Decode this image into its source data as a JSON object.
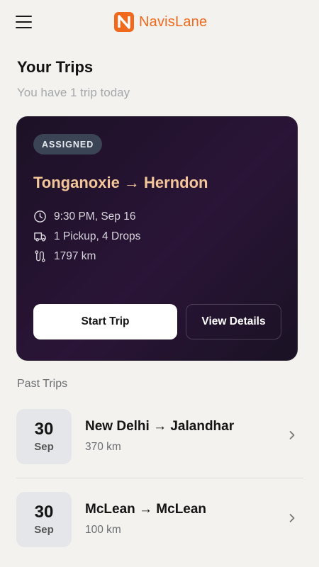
{
  "header": {
    "brand": "NavisLane",
    "menu_icon": "hamburger-menu-icon",
    "logo_icon": "navislane-logo",
    "brand_color": "#f06a1d"
  },
  "page": {
    "title": "Your Trips",
    "subtitle": "You have 1 trip today"
  },
  "current_trip": {
    "status": "ASSIGNED",
    "route": "Tonganoxie → Herndon",
    "time": "9:30 PM, Sep 16",
    "stops": "1  Pickup, 4 Drops",
    "distance": "1797 km",
    "start_label": "Start Trip",
    "details_label": "View Details",
    "accent_color": "#f6c69b"
  },
  "past_trips": {
    "title": "Past Trips",
    "items": [
      {
        "day": "30",
        "month": "Sep",
        "route": "New Delhi → Jalandhar",
        "distance": "370 km"
      },
      {
        "day": "30",
        "month": "Sep",
        "route": "McLean → McLean",
        "distance": "100 km"
      }
    ]
  }
}
